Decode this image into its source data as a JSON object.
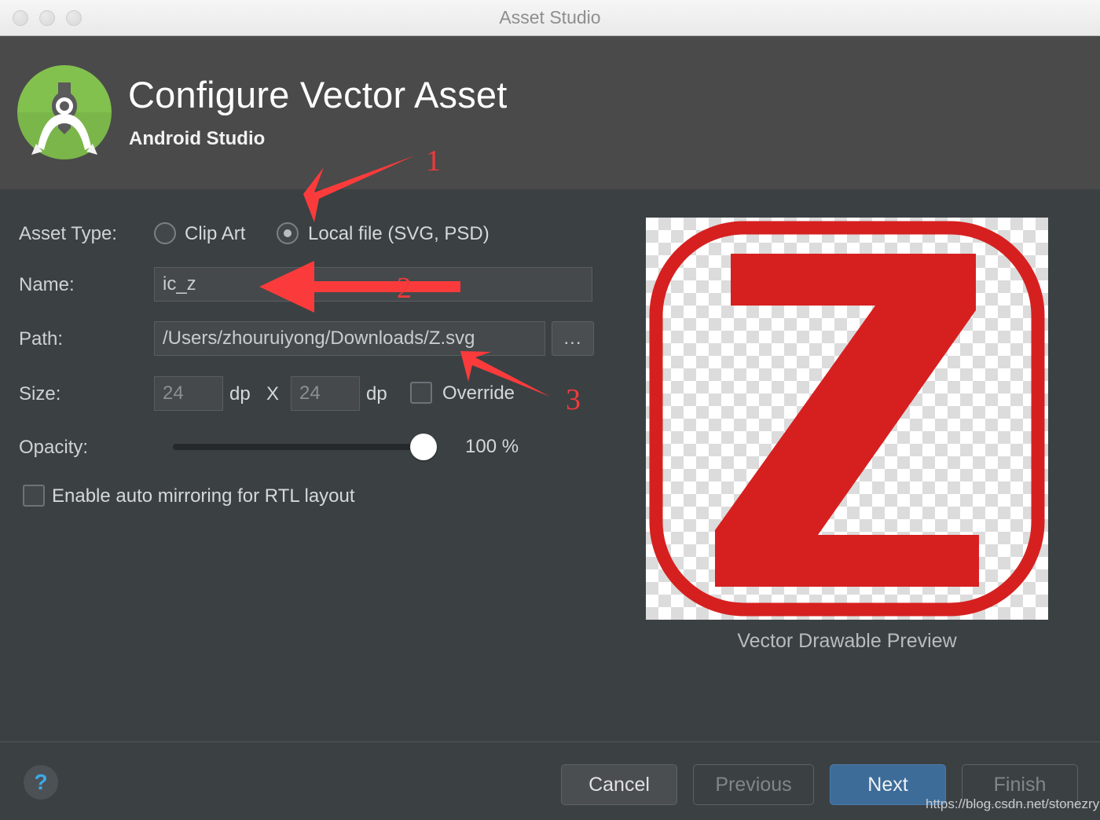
{
  "window": {
    "title": "Asset Studio",
    "traffic_lights": [
      "close-button",
      "minimize-button",
      "maximize-button"
    ]
  },
  "header": {
    "logo_icon": "android-studio-logo-icon",
    "title": "Configure Vector Asset",
    "subtitle": "Android Studio"
  },
  "form": {
    "asset_type": {
      "label": "Asset Type:",
      "options": [
        {
          "label": "Clip Art",
          "selected": false
        },
        {
          "label": "Local file (SVG, PSD)",
          "selected": true
        }
      ]
    },
    "name": {
      "label": "Name:",
      "value": "ic_z",
      "placeholder": "ic_z"
    },
    "path": {
      "label": "Path:",
      "value": "/Users/zhouruiyong/Downloads/Z.svg",
      "placeholder": "/Users/zhouruiyong/Downloads/Z.svg",
      "browse_label": "..."
    },
    "size": {
      "label": "Size:",
      "width_value": "24",
      "height_value": "24",
      "unit_width": "dp",
      "separator": "X",
      "unit_height": "dp",
      "override_label": "Override",
      "override_checked": false
    },
    "opacity": {
      "label": "Opacity:",
      "value": 100,
      "value_label": "100 %",
      "min": 0,
      "max": 100
    },
    "rtl": {
      "label": "Enable auto mirroring for RTL layout",
      "checked": false
    }
  },
  "preview": {
    "caption": "Vector Drawable Preview",
    "glyph": "Z",
    "glyph_color": "#d62020",
    "background": "transparency-checkerboard"
  },
  "footer": {
    "help_label": "?",
    "buttons": [
      {
        "name": "cancel",
        "label": "Cancel",
        "state": "enabled"
      },
      {
        "name": "previous",
        "label": "Previous",
        "state": "disabled"
      },
      {
        "name": "next",
        "label": "Next",
        "state": "primary"
      },
      {
        "name": "finish",
        "label": "Finish",
        "state": "disabled"
      }
    ]
  },
  "watermark": "https://blog.csdn.net/stonezry",
  "annotations": [
    {
      "number": "1",
      "target": "local-file-radio"
    },
    {
      "number": "2",
      "target": "name-input"
    },
    {
      "number": "3",
      "target": "path-input"
    }
  ],
  "colors": {
    "header_band": "#4a4a4a",
    "body": "#3b4043",
    "accent_primary": "#3e6c99",
    "annotation_red": "#f03a3a",
    "help_blue": "#3ca9e8",
    "logo_green": "#82c14e"
  }
}
